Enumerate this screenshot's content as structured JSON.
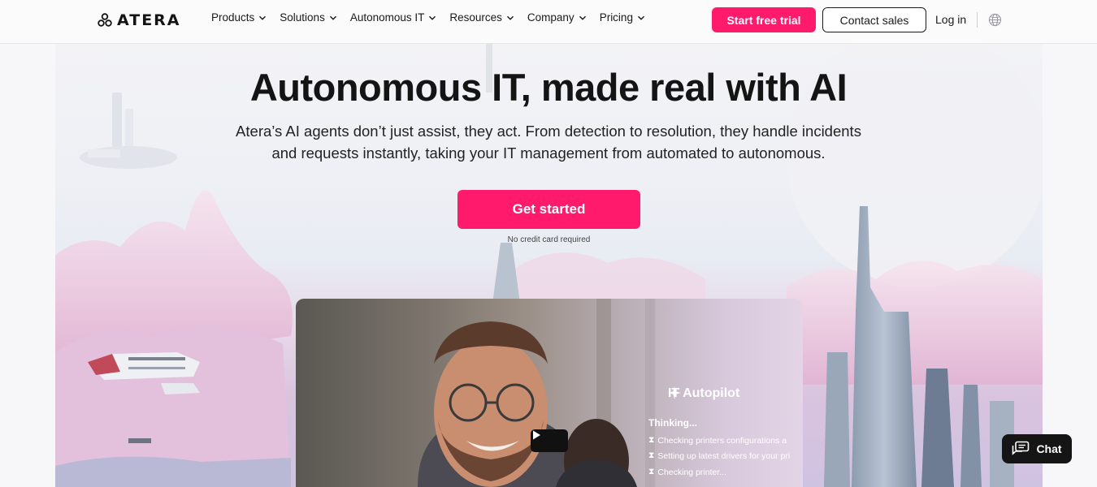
{
  "nav": {
    "logo_text": "ATERA",
    "menu": [
      {
        "label": "Products"
      },
      {
        "label": "Solutions"
      },
      {
        "label": "Autonomous IT"
      },
      {
        "label": "Resources"
      },
      {
        "label": "Company"
      },
      {
        "label": "Pricing"
      }
    ],
    "trial_label": "Start free trial",
    "sales_label": "Contact sales",
    "login_label": "Log in"
  },
  "hero": {
    "title": "Autonomous IT, made real with AI",
    "subtitle_line1": "Atera’s AI agents don’t just assist, they act. From detection to resolution, they handle incidents",
    "subtitle_line2": "and requests instantly, taking your IT management from automated to autonomous.",
    "cta_label": "Get started",
    "cta_note": "No credit card required"
  },
  "video": {
    "panel_title": "IT Autopilot",
    "thinking": "Thinking...",
    "steps": [
      "Checking printers configurations a",
      "Setting up latest drivers for your pri",
      "Checking printer..."
    ]
  },
  "chat": {
    "label": "Chat"
  },
  "colors": {
    "brand": "#ff1a6b",
    "dark": "#141414"
  }
}
